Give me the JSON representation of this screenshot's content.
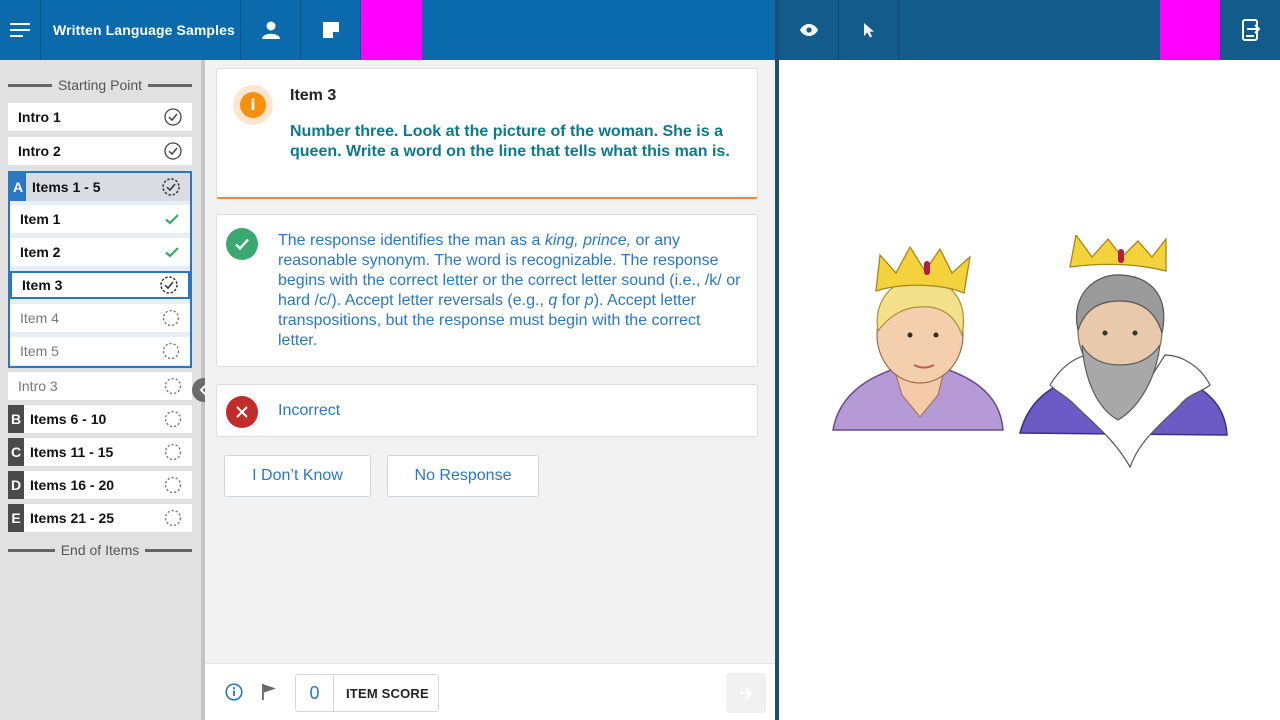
{
  "header": {
    "app_title": "Written Language Samples",
    "icons": [
      "menu-icon",
      "person-icon",
      "note-icon",
      "eye-icon",
      "cursor-icon",
      "exit-icon"
    ],
    "brand_color": "#0a6aac"
  },
  "sidebar": {
    "start_label": "Starting Point",
    "end_label": "End of Items",
    "intro1": {
      "label": "Intro 1",
      "status": "complete"
    },
    "intro2": {
      "label": "Intro 2",
      "status": "complete"
    },
    "group_a": {
      "letter": "A",
      "label": "Items 1 - 5",
      "status": "in-progress",
      "items": [
        {
          "label": "Item 1",
          "status": "answered"
        },
        {
          "label": "Item 2",
          "status": "answered"
        },
        {
          "label": "Item 3",
          "status": "current"
        },
        {
          "label": "Item 4",
          "status": "not-started"
        },
        {
          "label": "Item 5",
          "status": "not-started"
        }
      ]
    },
    "intro3": {
      "label": "Intro 3",
      "status": "not-started"
    },
    "groups": [
      {
        "letter": "B",
        "label": "Items 6 - 10",
        "status": "not-started"
      },
      {
        "letter": "C",
        "label": "Items 11 - 15",
        "status": "not-started"
      },
      {
        "letter": "D",
        "label": "Items 16 - 20",
        "status": "not-started"
      },
      {
        "letter": "E",
        "label": "Items 21 - 25",
        "status": "not-started"
      }
    ]
  },
  "item": {
    "title": "Item 3",
    "prompt": "Number three. Look at the picture of the woman. She is a queen. Write a word on the line that tells what this man is."
  },
  "scoring": {
    "correct": {
      "t1": "The response identifies the man as a ",
      "em1": "king, prince,",
      "t2": " or any reasonable synonym. The word is recognizable. The response begins with the correct letter or the correct letter sound (i.e., /k/ or hard /c/). Accept letter reversals (e.g., ",
      "em2": "q",
      "t3": " for ",
      "em3": "p",
      "t4": "). Accept letter transpositions, but the response must begin with the correct letter."
    },
    "incorrect_label": "Incorrect",
    "options": {
      "idk": "I Don’t Know",
      "no_response": "No Response"
    }
  },
  "footer": {
    "score_value": "0",
    "score_label": "ITEM SCORE"
  },
  "picture": {
    "description_icons": [
      "queen-figure",
      "king-figure"
    ]
  }
}
